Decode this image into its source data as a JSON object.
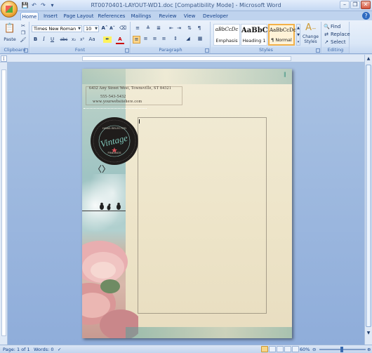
{
  "window": {
    "title": "RT0070401-LAYOUT-WD1.doc [Compatibility Mode] - Microsoft Word"
  },
  "tabs": [
    {
      "label": "Home",
      "active": true
    },
    {
      "label": "Insert"
    },
    {
      "label": "Page Layout"
    },
    {
      "label": "References"
    },
    {
      "label": "Mailings"
    },
    {
      "label": "Review"
    },
    {
      "label": "View"
    },
    {
      "label": "Developer"
    }
  ],
  "ribbon": {
    "clipboard": {
      "label": "Clipboard",
      "paste": "Paste"
    },
    "font": {
      "label": "Font",
      "family": "Times New Roman",
      "size": "10"
    },
    "paragraph": {
      "label": "Paragraph"
    },
    "styles": {
      "label": "Styles",
      "tiles": [
        {
          "sample": "aBbCcDc",
          "name": "Emphasis"
        },
        {
          "sample": "AaBbC",
          "name": "Heading 1"
        },
        {
          "sample": "AaBbCcDc",
          "name": "¶ Normal",
          "selected": true
        }
      ],
      "change_styles": "Change Styles"
    },
    "editing": {
      "label": "Editing",
      "find": "Find",
      "replace": "Replace",
      "select": "Select"
    }
  },
  "document": {
    "address_line": "6432 Any Street West, Townsville, ST 84321",
    "phone_line": "555-543-5432",
    "web_line": "www.yourwebsitehere.com",
    "badge": {
      "top_text": "HAND-SELECTED",
      "main_text": "Vintage",
      "bottom_text": "FINDINGS"
    }
  },
  "status": {
    "page": "Page: 1 of 1",
    "words": "Words: 0",
    "zoom": "60%"
  },
  "colors": {
    "ribbon_bg": "#dae7f7",
    "accent": "#f3b148",
    "page_bg": "#ede4c8",
    "workspace": "#9bb6de"
  }
}
